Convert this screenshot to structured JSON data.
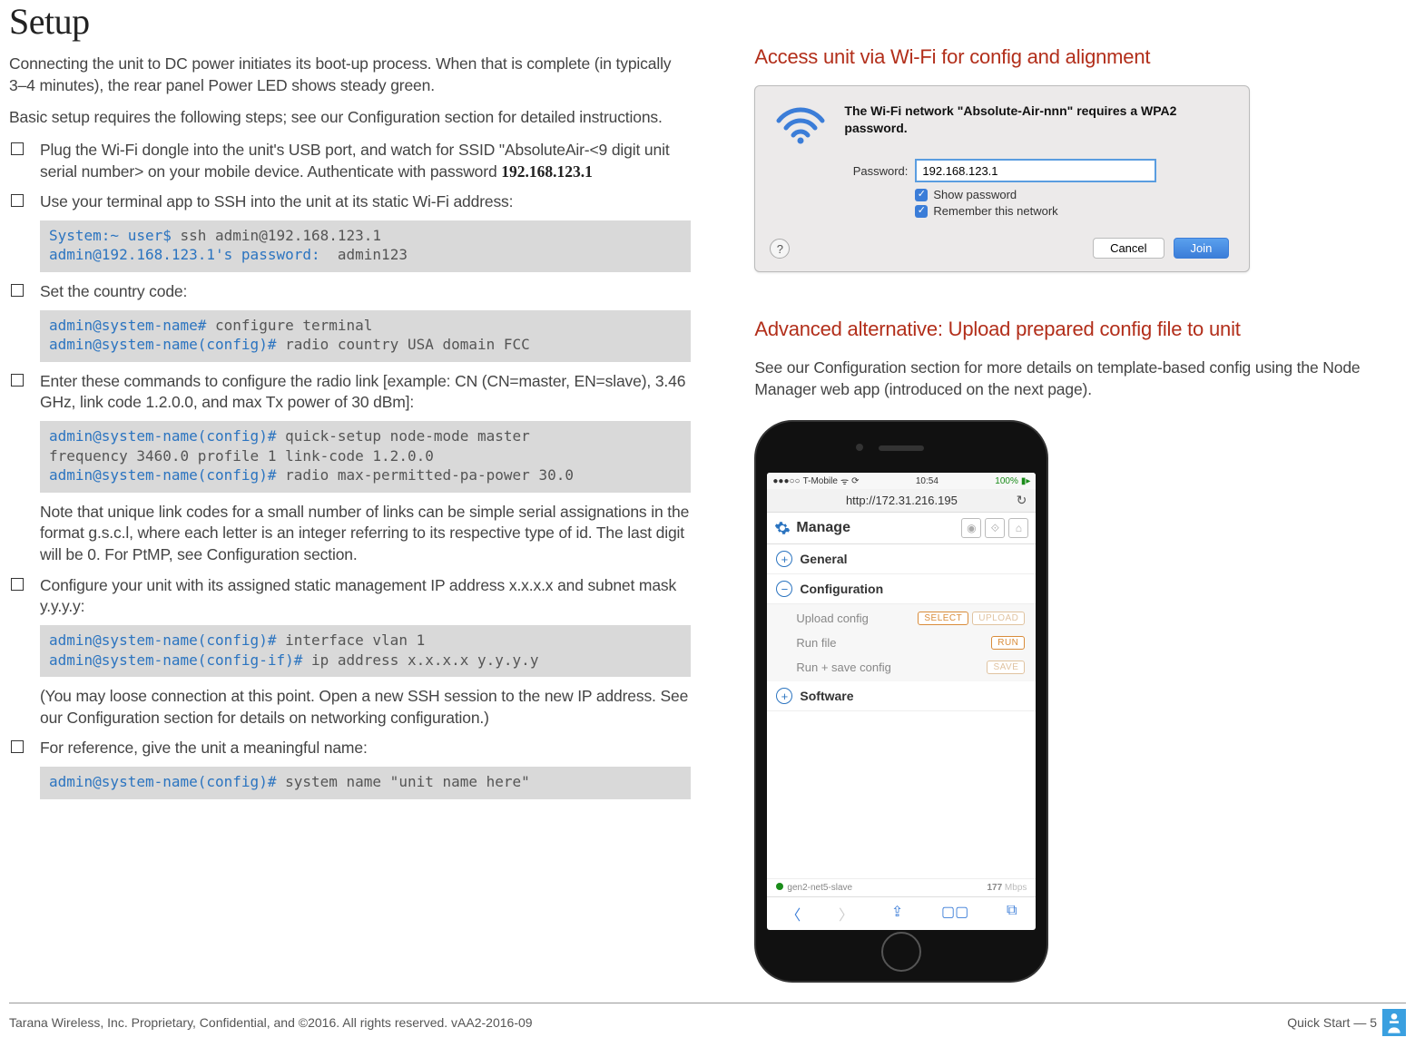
{
  "title": "Setup",
  "intro1": "Connecting the unit to DC power initiates its boot-up process.  When that is complete (in typically 3–4 minutes), the rear panel Power LED shows steady green.",
  "intro2": "Basic setup requires the following steps; see our Configuration section for detailed instructions.",
  "steps": {
    "s1_pre": "Plug the Wi-Fi dongle into the unit's USB port, and watch for SSID \"AbsoluteAir-<9 digit unit serial number> on your mobile device.  Authenticate with password ",
    "s1_ip": "192.168.123.1",
    "s2": "Use your terminal app to SSH into the unit at its static Wi-Fi address:",
    "s3": "Set the country code:",
    "s4": "Enter these commands to configure the radio link [example: CN (CN=master, EN=slave), 3.46 GHz, link code 1.2.0.0, and max Tx power of 30 dBm]:",
    "s4_note": "Note that unique link codes for a small number of links can be simple serial assignations in the format g.s.c.l, where each letter is an integer referring to its respective type of id.  The last digit will be 0.  For PtMP, see Configuration section.",
    "s5": "Configure your unit with its assigned static management IP address  x.x.x.x and subnet mask y.y.y.y:",
    "s5_note": "(You may loose connection at this point.  Open a new SSH session to the new IP address.  See our Configuration section for details on networking configuration.)",
    "s6": "For reference, give the unit a meaningful name:"
  },
  "code": {
    "c2_p1": "System:~ user$",
    "c2_t1": " ssh admin@192.168.123.1",
    "c2_p2": "admin@192.168.123.1's password:",
    "c2_t2": "  admin123",
    "c3_p1": "admin@system-name#",
    "c3_t1": " configure terminal",
    "c3_p2": "admin@system-name(config)#",
    "c3_t2": " radio country USA domain FCC",
    "c4_p1": "admin@system-name(config)#",
    "c4_t1": " quick-setup node-mode master",
    "c4_l2": "frequency 3460.0 profile 1 link-code 1.2.0.0",
    "c4_p3": "admin@system-name(config)#",
    "c4_t3": " radio max-permitted-pa-power 30.0",
    "c5_p1": "admin@system-name(config)#",
    "c5_t1": " interface vlan 1",
    "c5_p2": "admin@system-name(config-if)#",
    "c5_t2": " ip address x.x.x.x y.y.y.y",
    "c6_p1": "admin@system-name(config)#",
    "c6_t1": " system name \"unit name here\""
  },
  "right": {
    "h1": "Access unit via Wi-Fi for config and alignment",
    "h2": "Advanced alternative:  Upload prepared config file to unit",
    "p2": "See our Configuration section for more details on template-based config using the Node Manager web app (introduced on the next page)."
  },
  "wifi": {
    "msg": "The Wi-Fi network \"Absolute-Air-nnn\" requires a WPA2 password.",
    "password_label": "Password:",
    "password_value": "192.168.123.1",
    "show_pw": "Show password",
    "remember": "Remember this network",
    "cancel": "Cancel",
    "join": "Join"
  },
  "phone": {
    "carrier": "T-Mobile",
    "time": "10:54",
    "battery": "100%",
    "url": "http://172.31.216.195",
    "manage": "Manage",
    "general": "General",
    "configuration": "Configuration",
    "upload_config": "Upload config",
    "select": "SELECT",
    "upload": "UPLOAD",
    "run_file": "Run file",
    "run": "RUN",
    "run_save": "Run + save config",
    "save": "SAVE",
    "software": "Software",
    "node_name": "gen2-net5-slave",
    "throughput": "177",
    "throughput_unit": " Mbps"
  },
  "footer": {
    "left": "Tarana Wireless, Inc. Proprietary, Confidential, and ©2016.  All rights reserved.  vAA2-2016-09",
    "right": "Quick Start — 5"
  }
}
